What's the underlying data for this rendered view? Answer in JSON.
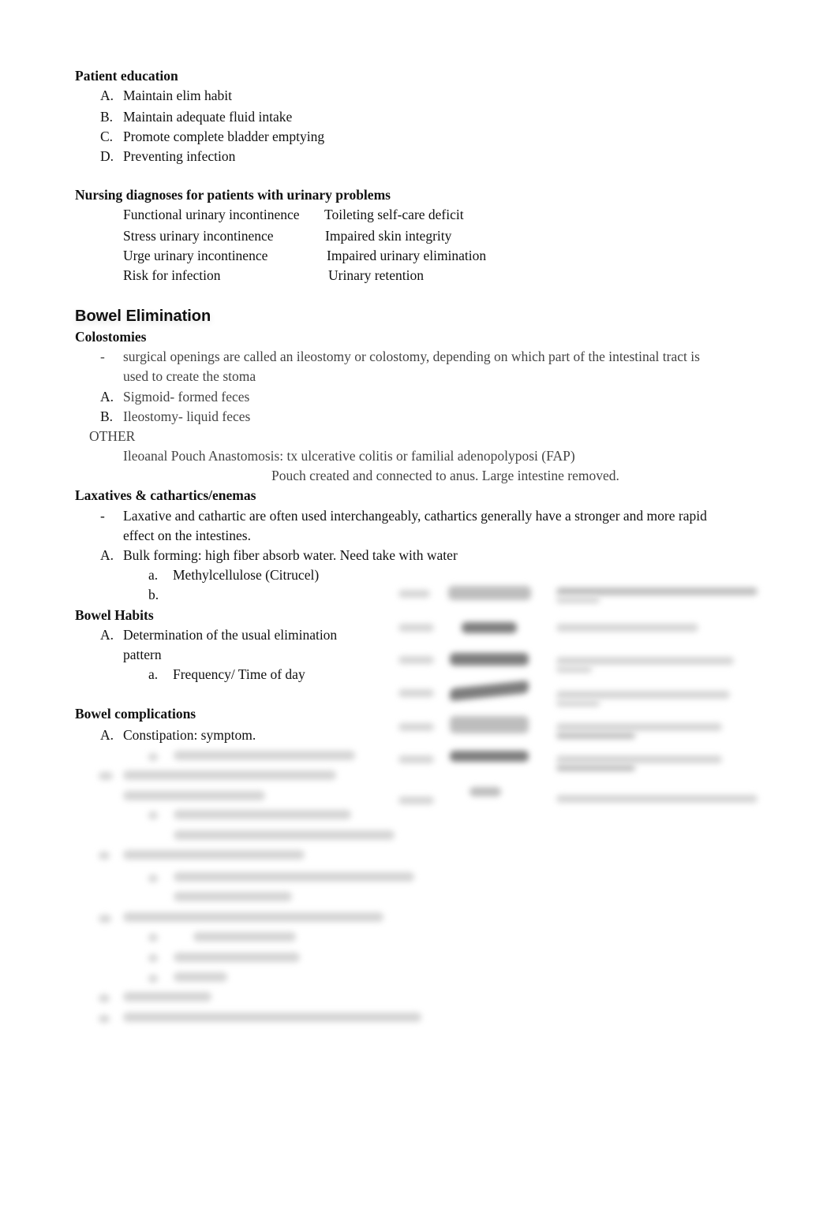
{
  "patient_education": {
    "heading": "Patient education",
    "items": [
      {
        "marker": "A.",
        "text": "Maintain elim habit"
      },
      {
        "marker": "B.",
        "text": "Maintain adequate fluid intake"
      },
      {
        "marker": "C.",
        "text": "Promote complete bladder emptying"
      },
      {
        "marker": "D.",
        "text": "Preventing infection"
      }
    ]
  },
  "nursing_diagnoses": {
    "heading": "Nursing diagnoses for patients with urinary problems",
    "rows": [
      {
        "left": "Functional urinary incontinence",
        "right": "Toileting self-care deficit"
      },
      {
        "left": "Stress urinary incontinence",
        "right": "Impaired skin integrity"
      },
      {
        "left": "Urge urinary incontinence",
        "right": "Impaired urinary elimination"
      },
      {
        "left": "Risk for infection",
        "right": "Urinary retention"
      }
    ]
  },
  "bowel_elimination": {
    "title": "Bowel Elimination",
    "colostomies": {
      "heading": "Colostomies",
      "bullet_marker": "-",
      "bullet_line1": "surgical openings are called an ileostomy or colostomy, depending on which part of the intestinal tract is",
      "bullet_line2": "used to create the stoma",
      "items": [
        {
          "marker": "A.",
          "text": "Sigmoid- formed feces"
        },
        {
          "marker": "B.",
          "text": "Ileostomy- liquid feces"
        }
      ],
      "other_label": "OTHER",
      "other_line1": "Ileoanal Pouch Anastomosis: tx ulcerative colitis or familial adenopolyposi (FAP)",
      "other_line2": "Pouch created and connected to anus. Large intestine removed."
    },
    "laxatives": {
      "heading": "Laxatives & cathartics/enemas",
      "bullet_marker": "-",
      "bullet_line1": "Laxative and cathartic are often used interchangeably, cathartics generally have a stronger and more rapid",
      "bullet_line2": "effect on the intestines.",
      "item_a_marker": "A.",
      "item_a_text": "Bulk forming: high fiber absorb water. Need take with water",
      "sub_items": [
        {
          "marker": "a.",
          "text": "Methylcellulose (Citrucel)"
        },
        {
          "marker": "b.",
          "text": ""
        }
      ]
    },
    "bowel_habits": {
      "heading": "Bowel Habits",
      "item_a_marker": "A.",
      "item_a_line1": "Determination of the usual elimination",
      "item_a_line2": "pattern",
      "sub_marker": "a.",
      "sub_text": "Frequency/ Time of day"
    },
    "complications": {
      "heading": "Bowel complications",
      "item_a_marker": "A.",
      "item_a_text": "Constipation: symptom."
    }
  }
}
